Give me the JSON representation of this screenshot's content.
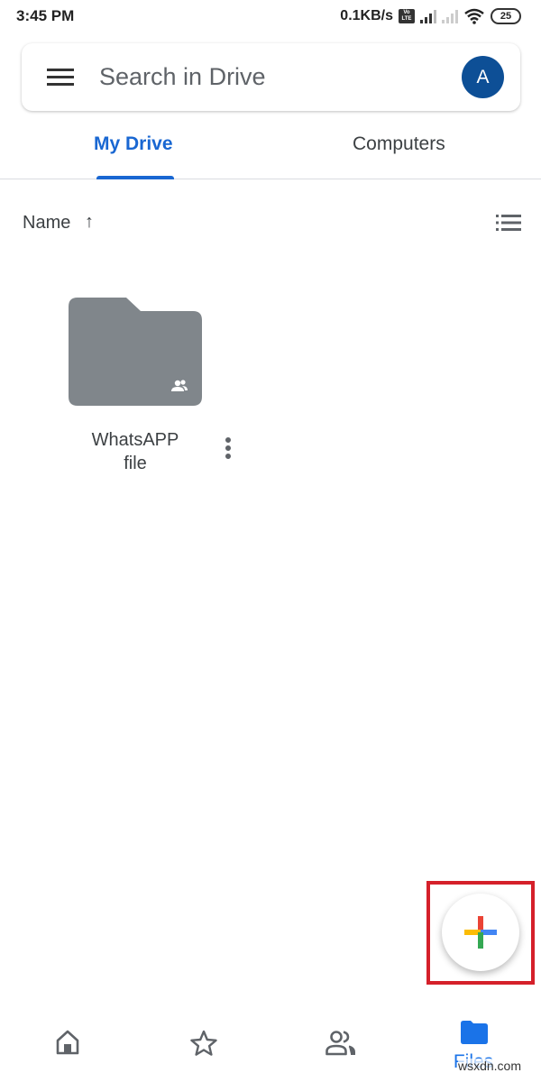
{
  "status_bar": {
    "time": "3:45 PM",
    "net_speed": "0.1KB/s",
    "volte_label": "Vo LTE",
    "battery": "25"
  },
  "search": {
    "placeholder": "Search in Drive",
    "avatar_initial": "A",
    "avatar_color": "#0d4f96"
  },
  "tabs": [
    {
      "label": "My Drive",
      "active": true
    },
    {
      "label": "Computers",
      "active": false
    }
  ],
  "sort": {
    "label": "Name",
    "direction": "ascending",
    "arrow": "↑"
  },
  "files": [
    {
      "name": "WhatsAPP file",
      "type": "shared-folder",
      "color": "#80868b"
    }
  ],
  "fab": {
    "icon": "plus-icon",
    "colors": {
      "red": "#ea4335",
      "yellow": "#fbbc04",
      "blue": "#4285f4",
      "green": "#34a853"
    },
    "highlight_color": "#d5202a"
  },
  "bottom_nav": [
    {
      "icon": "home-icon",
      "label": "",
      "active": false
    },
    {
      "icon": "star-icon",
      "label": "",
      "active": false
    },
    {
      "icon": "shared-icon",
      "label": "",
      "active": false
    },
    {
      "icon": "folder-icon",
      "label": "Files",
      "active": true
    }
  ],
  "accent_color": "#1a73e8",
  "watermark": "wsxdn.com"
}
